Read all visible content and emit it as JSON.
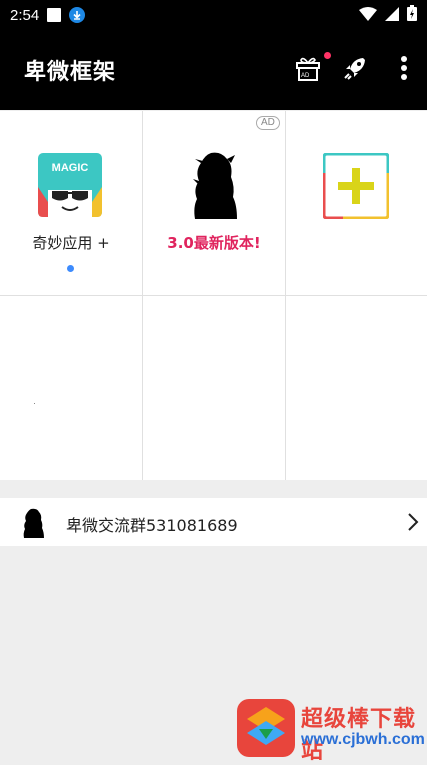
{
  "status_bar": {
    "time": "2:54",
    "icons": [
      "square-notification-icon",
      "download-icon",
      "wifi-icon",
      "signal-icon",
      "battery-charging-icon"
    ]
  },
  "app_bar": {
    "title": "卑微框架",
    "actions": [
      "gift-ad-icon",
      "rocket-icon",
      "more-vert-icon"
    ],
    "gift_ad_label": "AD",
    "background": "#000000"
  },
  "grid": {
    "items": [
      {
        "icon": "magic-app-icon",
        "icon_text": "MAGIC",
        "label": "奇妙应用 +",
        "has_dot": true
      },
      {
        "icon": "silhouette-avatar-icon",
        "label": "3.0最新版本!",
        "badge": "AD",
        "label_color": "#e0245e"
      },
      {
        "icon": "add-plus-icon",
        "label": ""
      },
      {
        "icon": "",
        "label": ""
      },
      {
        "icon": "",
        "label": ""
      },
      {
        "icon": "",
        "label": ""
      }
    ]
  },
  "list": {
    "items": [
      {
        "icon": "silhouette-avatar-icon",
        "label": "卑微交流群531081689",
        "trailing": "chevron-right-icon"
      }
    ]
  },
  "watermark": {
    "name": "超级棒下载站",
    "url": "www.cjbwh.com"
  },
  "colors": {
    "accent_red": "#e0245e",
    "dot_blue": "#3d8bfd",
    "background": "#eeeeee"
  }
}
